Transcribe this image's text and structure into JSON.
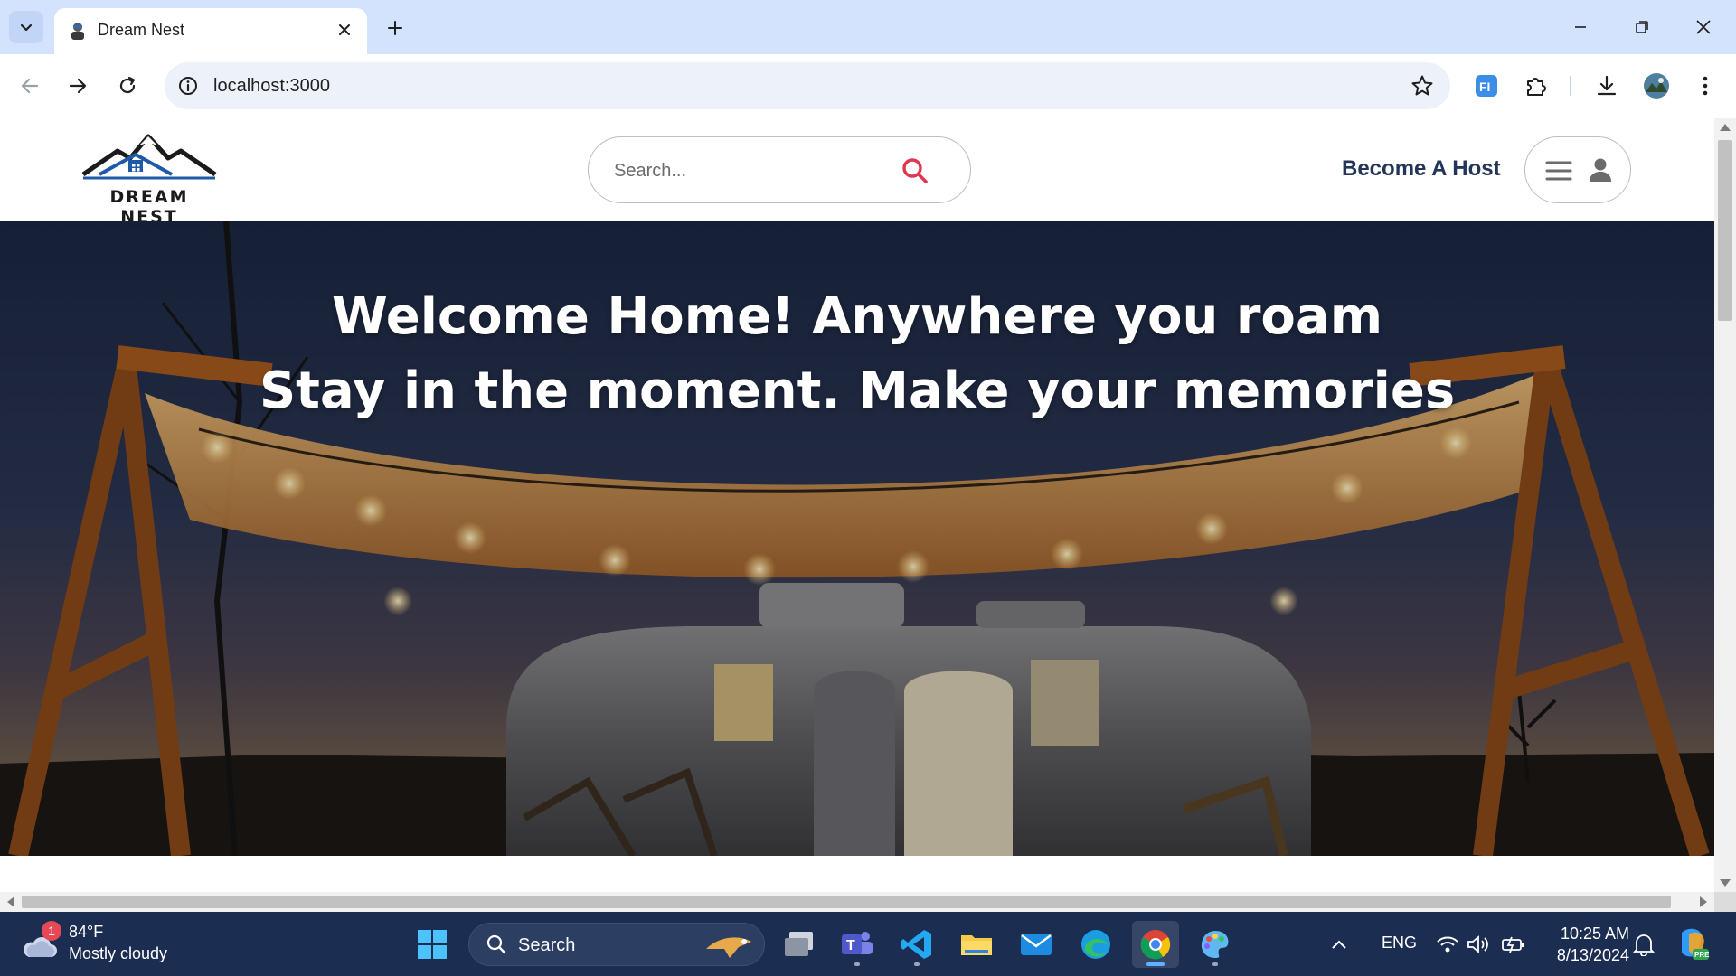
{
  "browser": {
    "tab": {
      "title": "Dream Nest"
    },
    "url": "localhost:3000",
    "colors": {
      "tabstrip": "#d3e3fd",
      "omnibox": "#edf2fa"
    },
    "icons": [
      "tab-search-icon",
      "close-icon",
      "new-tab-icon",
      "minimize-icon",
      "restore-icon",
      "window-close-icon",
      "back-icon",
      "forward-icon",
      "reload-icon",
      "site-info-icon",
      "bookmark-star-icon",
      "extension-fi-icon",
      "extensions-puzzle-icon",
      "download-icon",
      "profile-avatar-icon",
      "more-menu-icon"
    ]
  },
  "site": {
    "logo_text": "DREAM NEST",
    "search": {
      "placeholder": "Search..."
    },
    "become_host": "Become A Host",
    "accent_color": "#e0364f",
    "nav_text_color": "#24355a"
  },
  "hero": {
    "line1": "Welcome Home! Anywhere you roam",
    "line2": "Stay in the moment. Make your memories"
  },
  "taskbar": {
    "weather": {
      "temp": "84°F",
      "condition": "Mostly cloudy",
      "badge": "1"
    },
    "search_label": "Search",
    "language": "ENG",
    "time": "10:25 AM",
    "date": "8/13/2024",
    "apps": [
      "start-icon",
      "search-icon",
      "task-view-icon",
      "teams-icon",
      "vscode-icon",
      "file-explorer-icon",
      "mail-icon",
      "edge-icon",
      "chrome-icon",
      "paint-icon"
    ]
  }
}
